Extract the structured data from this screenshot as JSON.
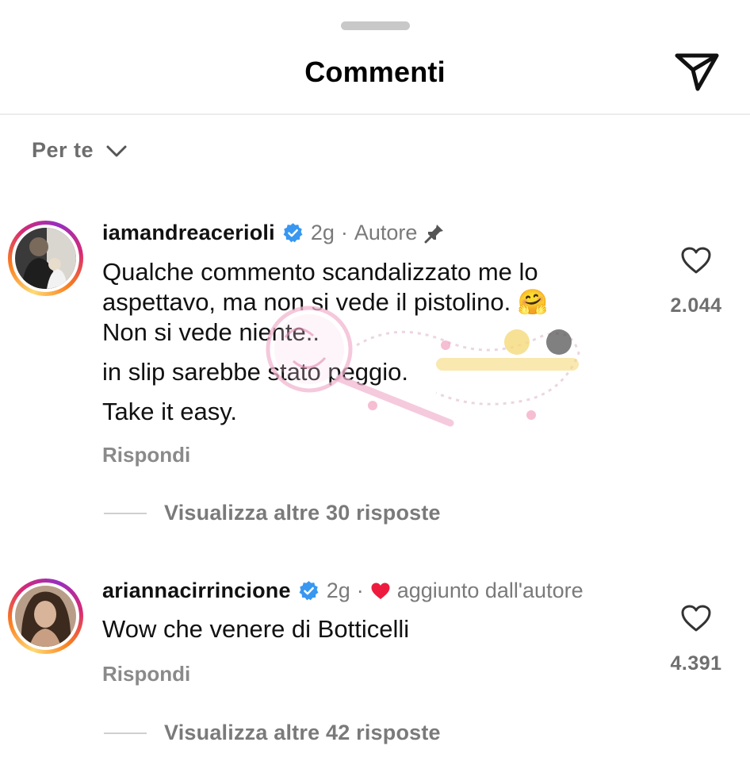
{
  "header": {
    "title": "Commenti",
    "share_icon": "paper-plane-icon"
  },
  "sort": {
    "label": "Per te",
    "icon": "chevron-down-icon"
  },
  "comments": [
    {
      "username": "iamandreacerioli",
      "verified": true,
      "time": "2g",
      "tag": "Autore",
      "tag_icon": "pin-icon",
      "lines": [
        "Qualche commento scandalizzato me lo",
        "aspettavo, ma non si vede il pistolino. 🤗",
        "Non si vede niente..",
        "in slip sarebbe stato peggio.",
        "Take it easy."
      ],
      "reply_label": "Rispondi",
      "view_replies": "Visualizza altre 30 risposte",
      "likes": "2.044"
    },
    {
      "username": "ariannacirrincione",
      "verified": true,
      "time": "2g",
      "tag": "aggiunto dall'autore",
      "tag_icon": "heart-icon",
      "lines": [
        "Wow che venere di Botticelli"
      ],
      "reply_label": "Rispondi",
      "view_replies": "Visualizza altre 42 risposte",
      "likes": "4.391"
    }
  ],
  "colors": {
    "verified": "#3897f0",
    "heart": "#ed1c3f",
    "muted": "#7a7a7a"
  }
}
